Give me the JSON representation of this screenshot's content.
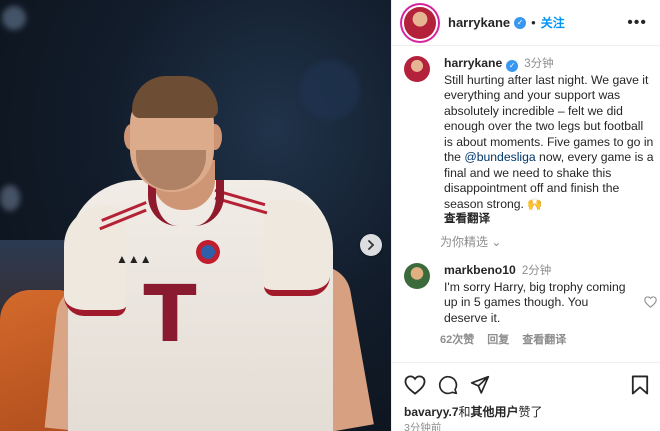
{
  "post": {
    "username": "harrykane",
    "verified": true,
    "follow_label": "关注",
    "more_label": "•••"
  },
  "caption": {
    "username": "harrykane",
    "time": "3分钟",
    "text_before": "Still hurting after last night. We gave it everything and your support was absolutely incredible – felt we did enough over the two legs but football is about moments. Five games to go in the ",
    "mention": "@bundesliga",
    "text_after": " now, every game is a final and we need to shake this disappointment off and finish the season strong. 🙌",
    "translate_label": "查看翻译"
  },
  "for_you_label": "为你精选 ⌄",
  "comment": {
    "username": "markbeno10",
    "time": "2分钟",
    "text": "I'm sorry Harry, big trophy coming up in 5 games though. You deserve it.",
    "likes_label": "62次赞",
    "reply_label": "回复",
    "translate_label": "查看翻译"
  },
  "footer": {
    "liked_by_user": "bavaryy.7",
    "liked_by_mid": "和",
    "liked_by_others": "其他用户",
    "liked_by_suffix": "赞了",
    "post_time": "3分钟前"
  },
  "photo": {
    "description_icons": [
      "next-arrow-icon"
    ]
  },
  "colors": {
    "accent": "#0095f6",
    "verified": "#3897f0",
    "secondary_text": "#8e8e8e",
    "kit_red": "#b52236"
  }
}
